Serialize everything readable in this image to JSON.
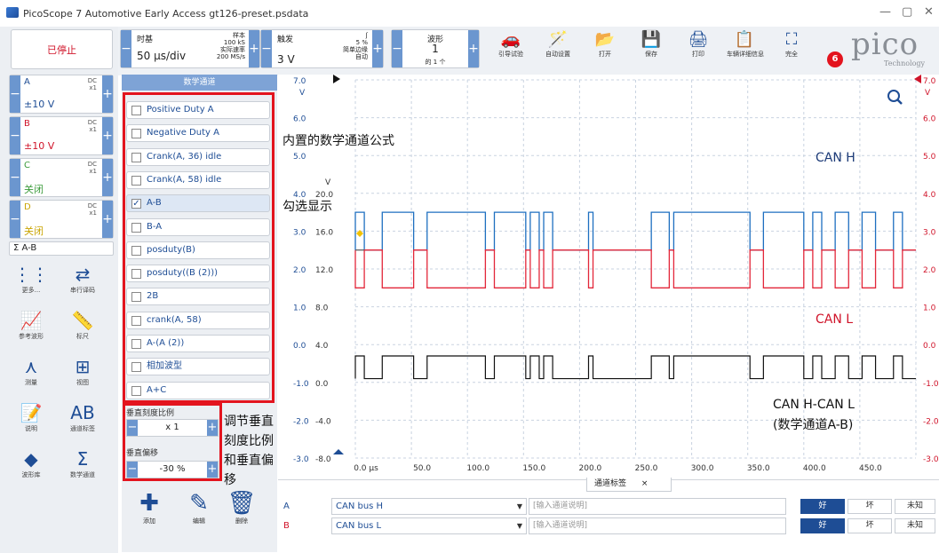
{
  "window": {
    "title": "PicoScope 7 Automotive Early Access gt126-preset.psdata",
    "min": "—",
    "max": "▢",
    "close": "✕"
  },
  "stop_label": "已停止",
  "timebase": {
    "label": "时基",
    "value": "50 µs/div",
    "sample_label": "样本",
    "samples": "100 kS",
    "rate_label": "实际速率",
    "rate": "200 MS/s"
  },
  "trigger": {
    "label": "触发",
    "value": "3 V",
    "pct": "5 %",
    "mode_label": "简单边缘",
    "mode": "自动"
  },
  "waveform": {
    "label": "波形",
    "count": "1",
    "of": "的 1 个"
  },
  "toolbar": [
    {
      "icon": "car-icon",
      "glyph": "🚗",
      "label": "引导试验"
    },
    {
      "icon": "wand-icon",
      "glyph": "🪄",
      "label": "自动设置"
    },
    {
      "icon": "folder-icon",
      "glyph": "📂",
      "label": "打开"
    },
    {
      "icon": "save-icon",
      "glyph": "💾",
      "label": "保存"
    },
    {
      "icon": "print-icon",
      "glyph": "🖨",
      "label": "打印"
    },
    {
      "icon": "report-icon",
      "glyph": "📋",
      "label": "车辆详细信息"
    },
    {
      "icon": "fullscreen-icon",
      "glyph": "⛶",
      "label": "完全"
    }
  ],
  "notification_count": "6",
  "brand": {
    "name": "pico",
    "sub": "Technology"
  },
  "channels": [
    {
      "name": "A",
      "coupling": "DC",
      "mult": "x1",
      "range": "±10 V",
      "color": "#1e4d95"
    },
    {
      "name": "B",
      "coupling": "DC",
      "mult": "x1",
      "range": "±10 V",
      "color": "#d0142a"
    },
    {
      "name": "C",
      "coupling": "DC",
      "mult": "x1",
      "range": "关闭",
      "color": "#3b9b3b"
    },
    {
      "name": "D",
      "coupling": "DC",
      "mult": "x1",
      "range": "关闭",
      "color": "#c9a400"
    }
  ],
  "math_channel_label": "Σ A-B",
  "tools": [
    {
      "icon": "more-icon",
      "glyph": "⋮⋮",
      "label": "更多..."
    },
    {
      "icon": "serial-decode-icon",
      "glyph": "⇄",
      "label": "串行译码"
    },
    {
      "icon": "reference-waveform-icon",
      "glyph": "📈",
      "label": "参考波形"
    },
    {
      "icon": "ruler-icon",
      "glyph": "📏",
      "label": "标尺"
    },
    {
      "icon": "measure-icon",
      "glyph": "⋏",
      "label": "测量"
    },
    {
      "icon": "view-icon",
      "glyph": "⊞",
      "label": "视图"
    },
    {
      "icon": "notes-icon",
      "glyph": "📝",
      "label": "说明"
    },
    {
      "icon": "channel-labels-icon",
      "glyph": "AB",
      "label": "通道标签"
    },
    {
      "icon": "waveform-library-icon",
      "glyph": "◆",
      "label": "波形库"
    },
    {
      "icon": "math-channel-icon",
      "glyph": "Σ",
      "label": "数学通道"
    }
  ],
  "math_panel": {
    "header": "数学通道",
    "items": [
      {
        "label": "Positive Duty A",
        "checked": false
      },
      {
        "label": "Negative Duty A",
        "checked": false
      },
      {
        "label": "Crank(A, 36) idle",
        "checked": false
      },
      {
        "label": "Crank(A, 58) idle",
        "checked": false
      },
      {
        "label": "A-B",
        "checked": true
      },
      {
        "label": "B-A",
        "checked": false
      },
      {
        "label": "posduty(B)",
        "checked": false
      },
      {
        "label": "posduty((B (2)))",
        "checked": false
      },
      {
        "label": "2B",
        "checked": false
      },
      {
        "label": "crank(A, 58)",
        "checked": false
      },
      {
        "label": "A-(A (2))",
        "checked": false
      },
      {
        "label": "相加波型",
        "checked": false
      },
      {
        "label": "A+C",
        "checked": false
      }
    ],
    "vscale_label": "垂直刻度比例",
    "vscale": "x 1",
    "voffset_label": "垂直偏移",
    "voffset": "-30 %",
    "actions": [
      {
        "icon": "add-icon",
        "glyph": "✚",
        "label": "添加"
      },
      {
        "icon": "edit-icon",
        "glyph": "✎",
        "label": "编辑"
      },
      {
        "icon": "delete-icon",
        "glyph": "🗑",
        "label": "删除"
      }
    ]
  },
  "annotations": {
    "builtin": "内置的数学通道公式",
    "check": "勾选显示",
    "adjust1": "调节垂直",
    "adjust2": "刻度比例",
    "adjust3": "和垂直偏",
    "adjust4": "移",
    "canh": "CAN H",
    "canl": "CAN L",
    "diff1": "CAN H-CAN L",
    "diff2": "(数学通道A-B)"
  },
  "plot": {
    "left_top": "7.0",
    "right_top": "7.0",
    "v_unit": "V",
    "left_ticks": [
      "6.0",
      "5.0",
      "4.0",
      "3.0",
      "2.0",
      "1.0",
      "0.0",
      "-1.0",
      "-2.0",
      "-3.0"
    ],
    "right_ticks": [
      "6.0",
      "5.0",
      "4.0",
      "3.0",
      "2.0",
      "1.0",
      "0.0",
      "-1.0",
      "-2.0",
      "-3.0"
    ],
    "math_ticks": [
      "20.0",
      "16.0",
      "12.0",
      "8.0",
      "4.0",
      "0.0",
      "-4.0",
      "-8.0"
    ],
    "x_ticks": [
      "0.0 µs",
      "50.0",
      "100.0",
      "150.0",
      "200.0",
      "250.0",
      "300.0",
      "350.0",
      "400.0",
      "450.0"
    ]
  },
  "channel_labels_tab": {
    "label": "通道标签",
    "close": "×"
  },
  "channel_table": [
    {
      "ch": "A",
      "name": "CAN bus H",
      "desc": "[输入通道说明]",
      "good": "好",
      "bad": "坏",
      "unknown": "未知",
      "color": "#1e4d95"
    },
    {
      "ch": "B",
      "name": "CAN bus L",
      "desc": "[输入通道说明]",
      "good": "好",
      "bad": "坏",
      "unknown": "未知",
      "color": "#d0142a"
    }
  ]
}
